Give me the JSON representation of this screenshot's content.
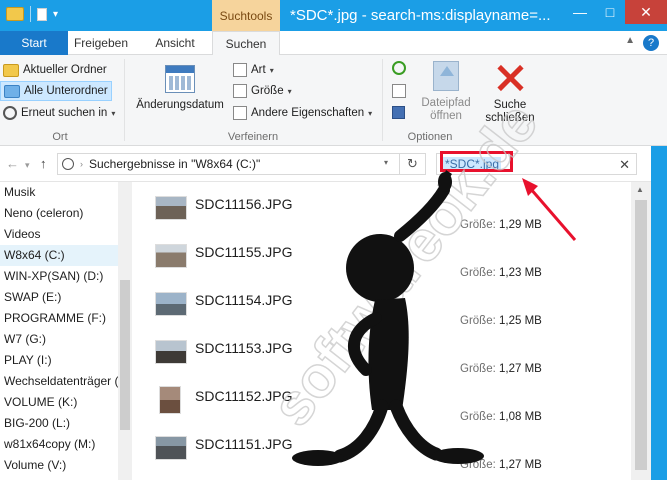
{
  "titlebar": {
    "contextual_tab": "Suchtools",
    "title": "*SDC*.jpg - search-ms:displayname=...",
    "minimize": "—",
    "maximize": "□",
    "close": "✕"
  },
  "ribbon_tabs": [
    "Start",
    "Freigeben",
    "Ansicht",
    "Suchen"
  ],
  "ribbon": {
    "ort": {
      "label": "Ort",
      "aktueller_ordner": "Aktueller Ordner",
      "alle_unterordner": "Alle Unterordner",
      "erneut_suchen_in": "Erneut suchen in"
    },
    "verfeinern": {
      "label": "Verfeinern",
      "aenderungsdatum": "Änderungsdatum",
      "art": "Art",
      "groesse": "Größe",
      "andere_eigenschaften": "Andere Eigenschaften"
    },
    "optionen": {
      "label": "Optionen",
      "dateipfad_line1": "Dateipfad",
      "dateipfad_line2": "öffnen"
    },
    "suche_schliessen_line1": "Suche",
    "suche_schliessen_line2": "schließen"
  },
  "addressbar": {
    "path": "Suchergebnisse in \"W8x64 (C:)\"",
    "search_value": "*SDC*.jpg",
    "clear": "✕"
  },
  "nav_items": [
    "Musik",
    "Neno (celeron)",
    "Videos",
    "W8x64 (C:)",
    "WIN-XP(SAN) (D:)",
    "SWAP (E:)",
    "PROGRAMME (F:)",
    "W7 (G:)",
    "PLAY (I:)",
    "Wechseldatenträger (J",
    "VOLUME (K:)",
    "BIG-200 (L:)",
    "w81x64copy (M:)",
    "Volume (V:)"
  ],
  "size_label": "Größe:",
  "files": [
    {
      "name": "SDC11156.JPG",
      "size": "1,29 MB"
    },
    {
      "name": "SDC11155.JPG",
      "size": "1,23 MB"
    },
    {
      "name": "SDC11154.JPG",
      "size": "1,25 MB"
    },
    {
      "name": "SDC11153.JPG",
      "size": "1,27 MB"
    },
    {
      "name": "SDC11152.JPG",
      "size": "1,08 MB"
    },
    {
      "name": "SDC11151.JPG",
      "size": "1,27 MB"
    }
  ],
  "watermark": "softwareok.de",
  "colors": {
    "titlebar": "#1b9ee6",
    "start_tab": "#1979ca",
    "contextual_tab": "#f6d49c",
    "highlight_red": "#e8112d"
  }
}
